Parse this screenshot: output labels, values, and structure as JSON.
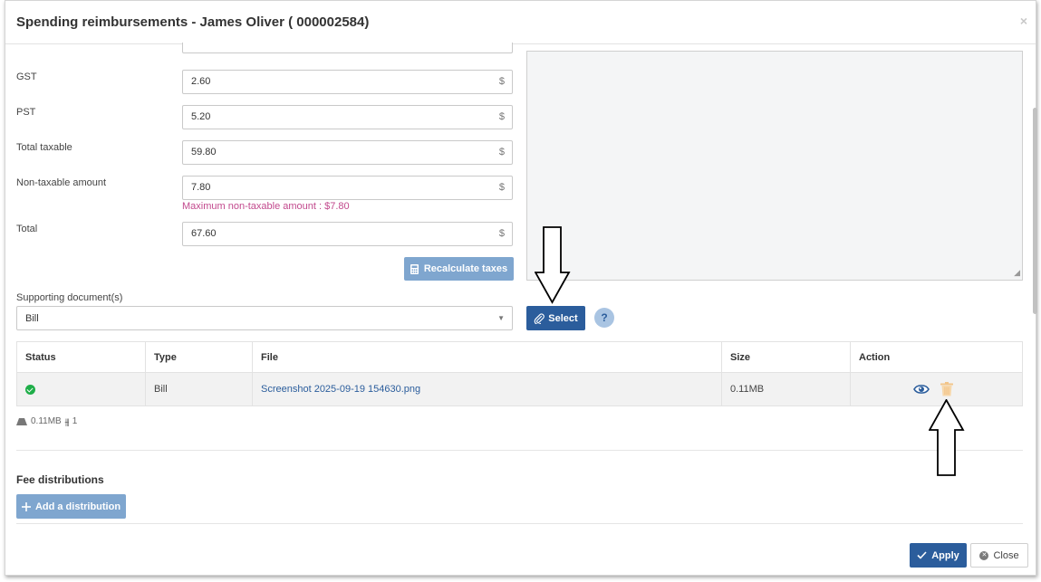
{
  "dialog": {
    "title": "Spending reimbursements - James Oliver ( 000002584)",
    "close_glyph": "×"
  },
  "form": {
    "currency_symbol": "$",
    "rows": [
      {
        "label": "GST",
        "value": "2.60"
      },
      {
        "label": "PST",
        "value": "5.20"
      },
      {
        "label": "Total taxable",
        "value": "59.80"
      },
      {
        "label": "Non-taxable amount",
        "value": "7.80"
      },
      {
        "label": "Total",
        "value": "67.60"
      }
    ],
    "non_taxable_hint": "Maximum non-taxable amount : $7.80",
    "recalculate_label": "Recalculate taxes"
  },
  "documents": {
    "label": "Supporting document(s)",
    "selected_type": "Bill",
    "select_button": "Select",
    "help_glyph": "?",
    "table": {
      "headers": [
        "Status",
        "Type",
        "File",
        "Size",
        "Action"
      ],
      "rows": [
        {
          "status": "ok",
          "type": "Bill",
          "file": "Screenshot 2025-09-19 154630.png",
          "size": "0.11MB"
        }
      ]
    },
    "summary_size": "0.11MB",
    "summary_count": "1"
  },
  "fees": {
    "title": "Fee distributions",
    "add_label": "Add a distribution"
  },
  "footer": {
    "apply_label": "Apply",
    "close_label": "Close"
  },
  "colors": {
    "primary": "#2b5d9c",
    "primary_disabled": "#7fa6cf",
    "hint": "#c2498d",
    "status_ok": "#1fae49",
    "delete_icon": "#f2c58a"
  }
}
